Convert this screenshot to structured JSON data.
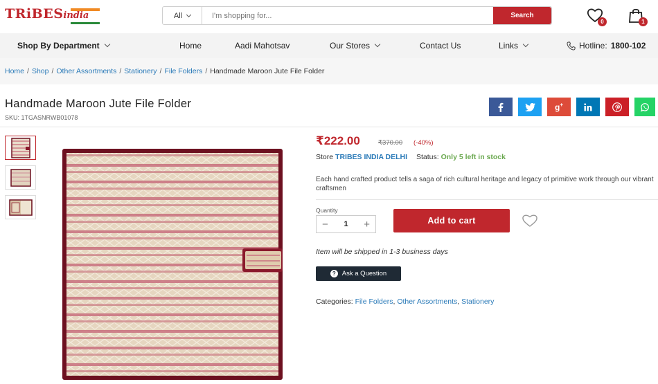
{
  "header": {
    "logo_main": "TRiBES",
    "logo_sub": "india",
    "search": {
      "category": "All",
      "placeholder": "I'm shopping for...",
      "button": "Search"
    },
    "wishlist_count": "0",
    "cart_count": "1"
  },
  "nav": {
    "department": "Shop By Department",
    "home": "Home",
    "aadi": "Aadi Mahotsav",
    "stores": "Our Stores",
    "contact": "Contact Us",
    "links": "Links",
    "hotline_label": "Hotline:",
    "hotline_number": "1800-102"
  },
  "breadcrumb": {
    "items": [
      "Home",
      "Shop",
      "Other Assortments",
      "Stationery",
      "File Folders"
    ],
    "current": "Handmade Maroon Jute File Folder"
  },
  "product": {
    "title": "Handmade Maroon Jute File Folder",
    "sku": "SKU: 1TGASNRWB01078",
    "price": "₹222.00",
    "old_price": "₹370.00",
    "discount": "(-40%)",
    "store_label": "Store",
    "store_name": "TRIBES INDIA DELHI",
    "status_label": "Status:",
    "status_value": "Only 5 left in stock",
    "description": "Each hand crafted product tells a saga of rich cultural heritage and legacy of primitive work through our vibrant craftsmen",
    "quantity_label": "Quantity",
    "quantity": "1",
    "add_to_cart": "Add to cart",
    "shipping": "Item will be shipped in 1-3 business days",
    "ask": "Ask a Question",
    "categories_label": "Categories:",
    "categories": [
      "File Folders",
      "Other Assortments",
      "Stationery"
    ]
  },
  "share": [
    {
      "icon": "facebook-icon",
      "glyph": "f",
      "color": "#3b5998"
    },
    {
      "icon": "twitter-icon",
      "glyph": "t",
      "color": "#1da1f2"
    },
    {
      "icon": "google-plus-icon",
      "glyph": "g+",
      "color": "#dd4b39"
    },
    {
      "icon": "linkedin-icon",
      "glyph": "in",
      "color": "#0077b5"
    },
    {
      "icon": "pinterest-icon",
      "glyph": "p",
      "color": "#cb2027"
    },
    {
      "icon": "whatsapp-icon",
      "glyph": "w",
      "color": "#25d366"
    }
  ],
  "colors": {
    "brand": "#c0272d",
    "link": "#2a7ab8",
    "stock": "#6aa84f"
  }
}
